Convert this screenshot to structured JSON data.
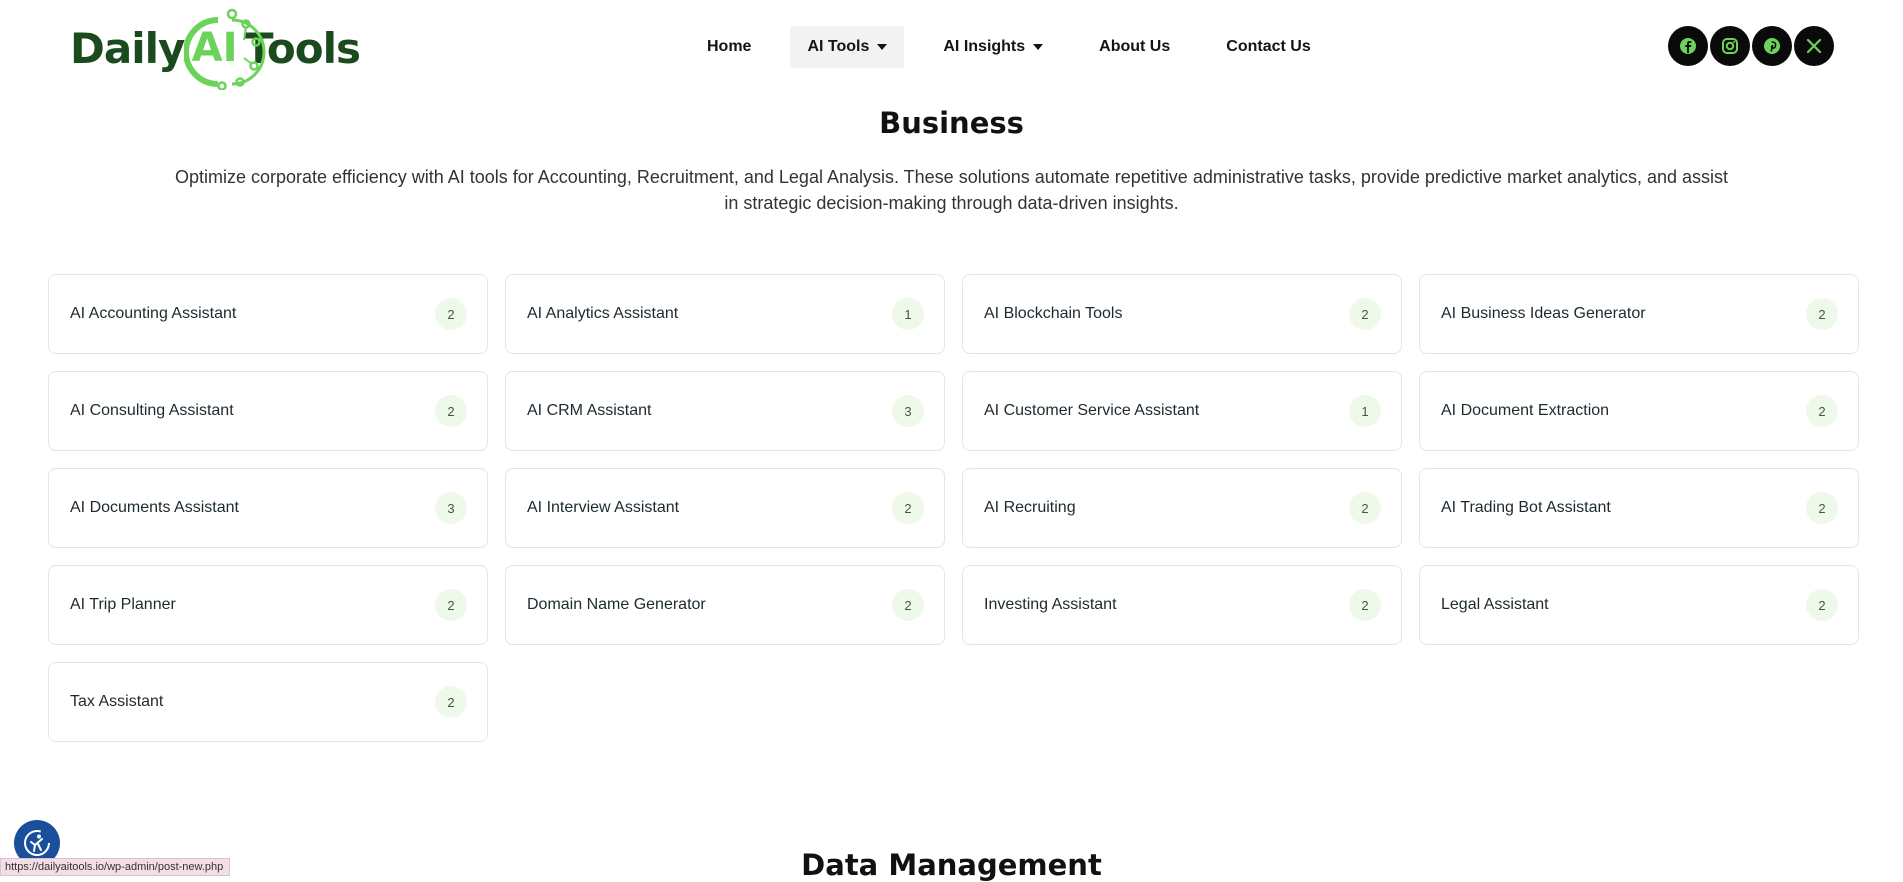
{
  "brand": {
    "word1": "Daily",
    "ai": "AI",
    "word2": "Tools",
    "dark_color": "#1a4a1e",
    "accent_color": "#6cd35a"
  },
  "nav": {
    "items": [
      {
        "label": "Home",
        "dropdown": false,
        "active": false
      },
      {
        "label": "AI Tools",
        "dropdown": true,
        "active": true
      },
      {
        "label": "AI Insights",
        "dropdown": true,
        "active": false
      },
      {
        "label": "About Us",
        "dropdown": false,
        "active": false
      },
      {
        "label": "Contact Us",
        "dropdown": false,
        "active": false
      }
    ]
  },
  "social": [
    {
      "icon": "facebook-icon"
    },
    {
      "icon": "instagram-icon"
    },
    {
      "icon": "pinterest-icon"
    },
    {
      "icon": "x-icon"
    }
  ],
  "section": {
    "title": "Business",
    "description": "Optimize corporate efficiency with AI tools for Accounting, Recruitment, and Legal Analysis. These solutions automate repetitive administrative tasks, provide predictive market analytics, and assist in strategic decision-making through data-driven insights."
  },
  "categories": [
    {
      "label": "AI Accounting Assistant",
      "count": "2"
    },
    {
      "label": "AI Analytics Assistant",
      "count": "1"
    },
    {
      "label": "AI Blockchain Tools",
      "count": "2"
    },
    {
      "label": "AI Business Ideas Generator",
      "count": "2"
    },
    {
      "label": "AI Consulting Assistant",
      "count": "2"
    },
    {
      "label": "AI CRM Assistant",
      "count": "3"
    },
    {
      "label": "AI Customer Service Assistant",
      "count": "1"
    },
    {
      "label": "AI Document Extraction",
      "count": "2"
    },
    {
      "label": "AI Documents Assistant",
      "count": "3"
    },
    {
      "label": "AI Interview Assistant",
      "count": "2"
    },
    {
      "label": "AI Recruiting",
      "count": "2"
    },
    {
      "label": "AI Trading Bot Assistant",
      "count": "2"
    },
    {
      "label": "AI Trip Planner",
      "count": "2"
    },
    {
      "label": "Domain Name Generator",
      "count": "2"
    },
    {
      "label": "Investing Assistant",
      "count": "2"
    },
    {
      "label": "Legal Assistant",
      "count": "2"
    },
    {
      "label": "Tax Assistant",
      "count": "2"
    }
  ],
  "next_section": {
    "title": "Data Management"
  },
  "status_bar": {
    "url": "https://dailyaitools.io/wp-admin/post-new.php"
  },
  "accessibility": {
    "icon": "accessibility-icon",
    "color": "#1a4f9c"
  }
}
